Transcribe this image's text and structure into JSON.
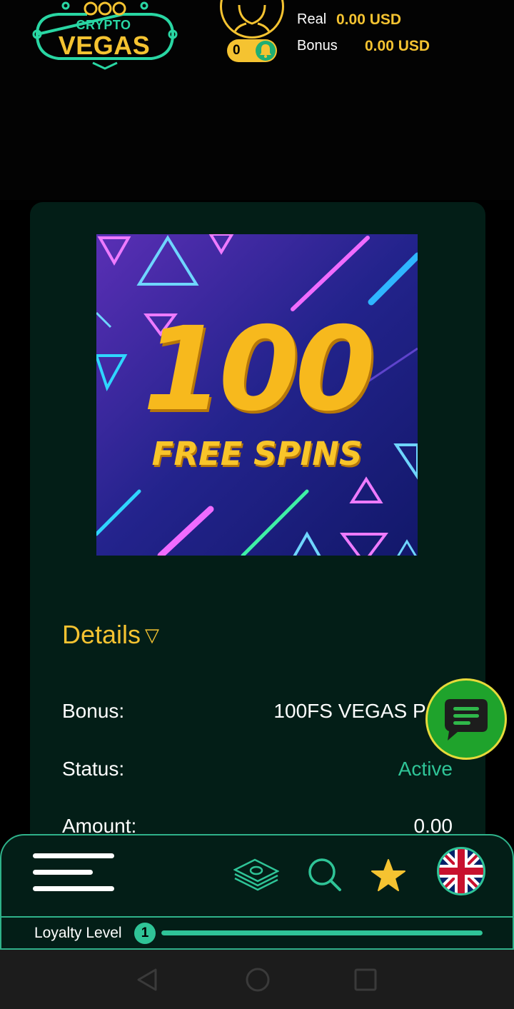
{
  "brand": {
    "top_word": "CRYPTO",
    "main_word": "VEGAS"
  },
  "colors": {
    "accent_gold": "#f5c331",
    "accent_green": "#2fc497",
    "card_bg": "#031e17",
    "chat_button": "#1fa32c"
  },
  "header": {
    "notifications_count": "0",
    "real_label": "Real",
    "real_amount": "0.00 USD",
    "bonus_label": "Bonus",
    "bonus_amount": "0.00 USD"
  },
  "promo": {
    "headline_number": "100",
    "headline_text": "FREE SPINS"
  },
  "details": {
    "toggle_label": "Details",
    "caret": "▽",
    "rows": [
      {
        "label": "Bonus:",
        "value": "100FS VEGAS POL"
      },
      {
        "label": "Status:",
        "value": "Active"
      },
      {
        "label": "Amount:",
        "value": "0.00"
      }
    ]
  },
  "bottom_nav": {
    "icons": [
      "menu-icon",
      "cash-icon",
      "search-icon",
      "star-icon",
      "uk-flag-icon"
    ]
  },
  "loyalty": {
    "label": "Loyalty Level",
    "level": "1",
    "progress": 1.0
  }
}
